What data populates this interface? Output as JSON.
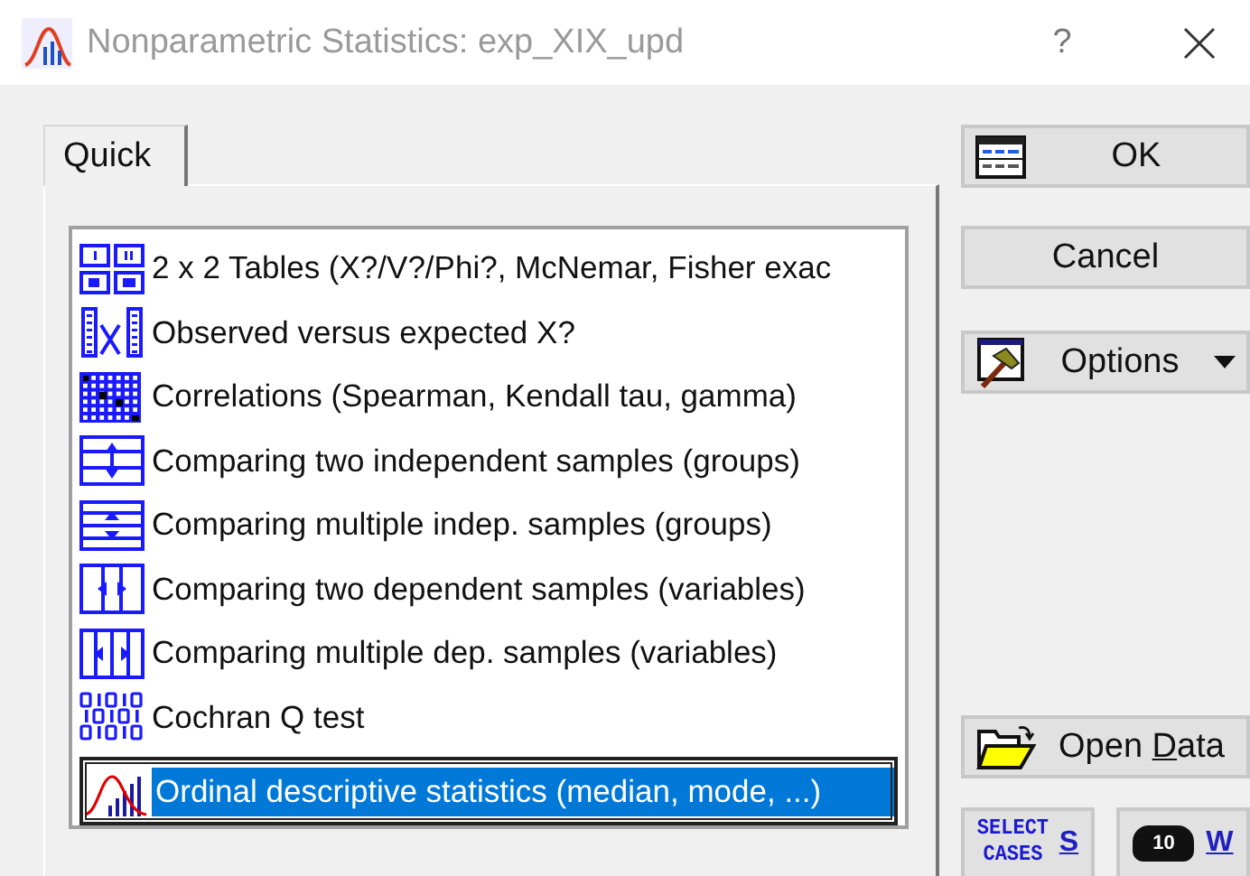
{
  "window": {
    "title": "Nonparametric Statistics: exp_XIX_upd",
    "help": "?"
  },
  "tabs": [
    {
      "label": "Quick",
      "selected": true
    }
  ],
  "list": [
    {
      "label": "2 x 2 Tables (X?/V?/Phi?, McNemar, Fisher exac",
      "selected": false,
      "separated": false
    },
    {
      "label": "Observed versus expected X?",
      "selected": false,
      "separated": false
    },
    {
      "label": "Correlations (Spearman, Kendall tau, gamma)",
      "selected": false,
      "separated": false
    },
    {
      "label": "Comparing two independent samples (groups)",
      "selected": false,
      "separated": false
    },
    {
      "label": "Comparing multiple indep. samples (groups)",
      "selected": false,
      "separated": false
    },
    {
      "label": "Comparing two dependent samples (variables)",
      "selected": false,
      "separated": false
    },
    {
      "label": "Comparing multiple dep. samples (variables)",
      "selected": false,
      "separated": false
    },
    {
      "label": "Cochran Q test",
      "selected": false,
      "separated": false
    },
    {
      "label": "Ordinal descriptive statistics (median, mode, ...)",
      "selected": true,
      "separated": true
    }
  ],
  "buttons": {
    "ok": "OK",
    "cancel": "Cancel",
    "options": "Options",
    "open_data": {
      "before": "Open ",
      "accelerator": "D",
      "after": "ata"
    },
    "select_cases": {
      "icon_lines": [
        "SELECT",
        "CASES"
      ],
      "accelerator": "S"
    },
    "weight": {
      "icon_text": "10",
      "accelerator": "W"
    }
  }
}
